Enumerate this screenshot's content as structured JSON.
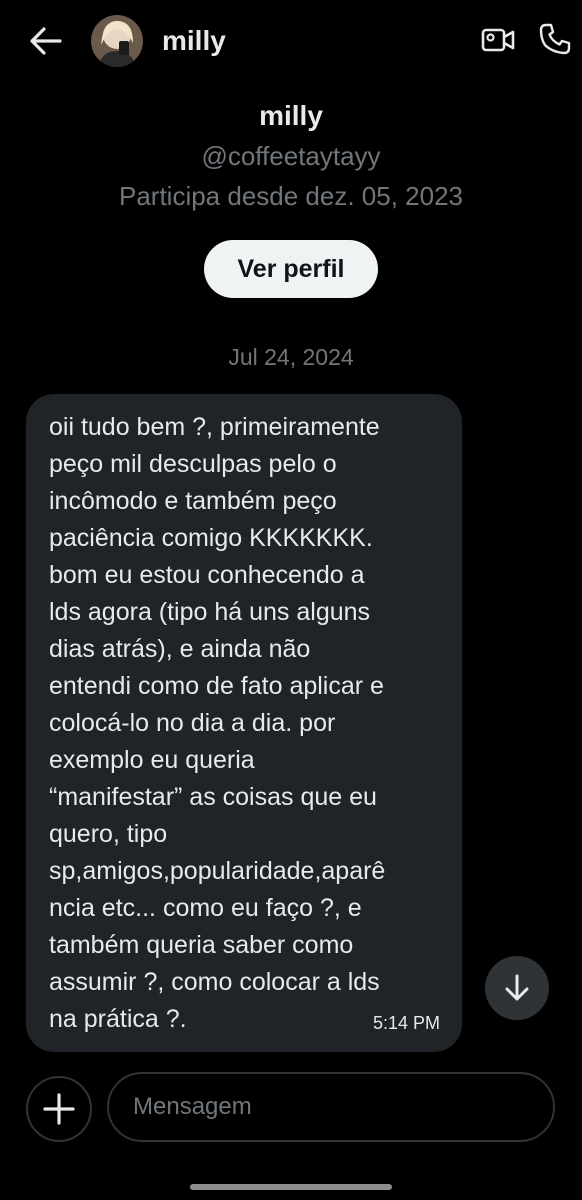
{
  "header": {
    "name": "milly"
  },
  "profile": {
    "name": "milly",
    "handle": "@coffeetaytayy",
    "joined": "Participa desde dez. 05, 2023",
    "view_profile_label": "Ver perfil"
  },
  "conversation": {
    "date": "Jul 24, 2024",
    "messages": [
      {
        "text": "oii tudo bem ?, primeiramente\npeço mil desculpas pelo o\nincômodo e também peço\npaciência comigo KKKKKKK.\nbom eu estou conhecendo a\nlds agora (tipo há uns alguns\ndias atrás), e ainda não\nentendi como de fato aplicar e\ncolocá-lo no dia a dia. por\nexemplo eu queria\n“manifestar” as coisas que eu\nquero, tipo\nsp,amigos,popularidade,aparê\nncia etc... como eu faço ?, e\ntambém queria saber como\nassumir ?, como colocar a lds\nna prática ?.",
        "time": "5:14 PM"
      }
    ]
  },
  "composer": {
    "placeholder": "Mensagem"
  },
  "icons": {
    "back": "arrow-left-icon",
    "video": "video-camera-icon",
    "call": "phone-icon",
    "scroll_down": "arrow-down-icon",
    "add": "plus-icon"
  },
  "colors": {
    "background": "#000000",
    "bubble": "#202327",
    "primary_text": "#e7e9ea",
    "secondary_text": "#71767b",
    "button_bg": "#eff3f4"
  }
}
